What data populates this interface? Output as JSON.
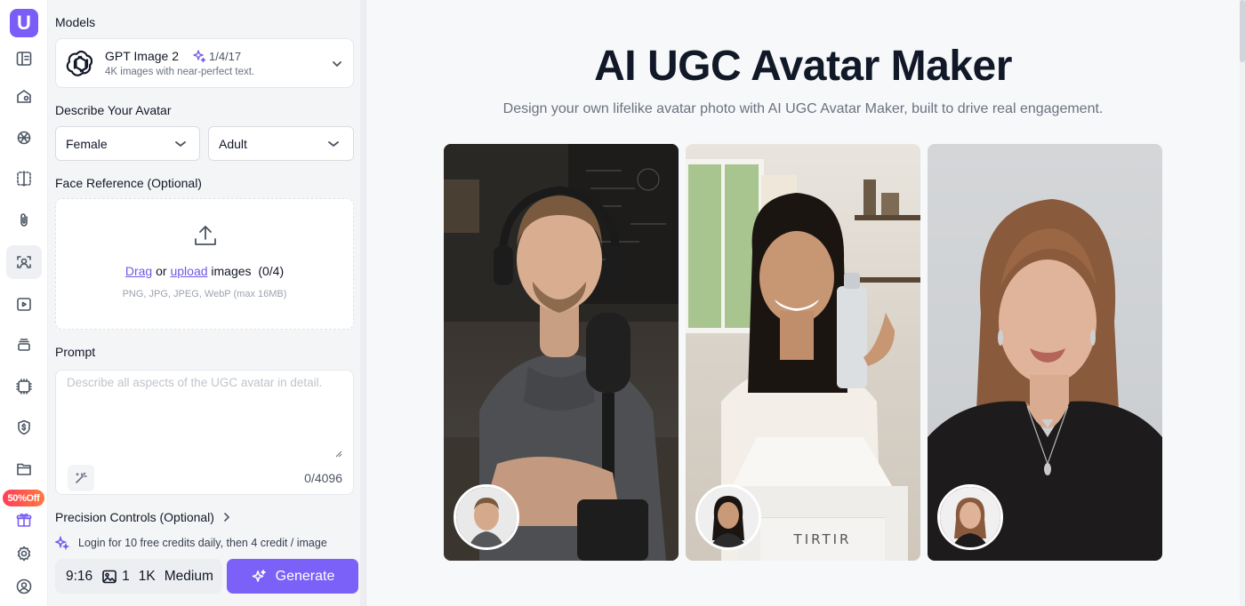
{
  "rail": {
    "logo": "U",
    "items": [
      "layout-icon",
      "house-icon",
      "openai-icon",
      "compare-icon",
      "paperclip-icon",
      "face-scan-icon",
      "video-add-icon",
      "stack-icon",
      "ai-chip-icon",
      "dollar-shield-icon",
      "folder-icon",
      "gift-icon",
      "settings-icon",
      "user-icon"
    ],
    "promo": "50%Off"
  },
  "panel": {
    "models_label": "Models",
    "model_name": "GPT Image 2",
    "model_version": "1/4/17",
    "model_desc": "4K images with near-perfect text.",
    "describe_label": "Describe Your Avatar",
    "gender": "Female",
    "age": "Adult",
    "face_label": "Face Reference (Optional)",
    "drag": "Drag",
    "or": "or",
    "upload": "upload",
    "images": "images",
    "upload_count": "(0/4)",
    "upload_hint": "PNG, JPG, JPEG, WebP (max 16MB)",
    "prompt_label": "Prompt",
    "prompt_placeholder": "Describe all aspects of the UGC avatar in detail.",
    "char_count": "0/4096",
    "precision_label": "Precision Controls (Optional)",
    "login_note": "Login for 10 free credits daily, then 4 credit / image",
    "aspect": "9:16",
    "image_count": "1",
    "resolution": "1K",
    "quality": "Medium",
    "generate": "Generate"
  },
  "main": {
    "title": "AI UGC Avatar Maker",
    "subtitle": "Design your own lifelike avatar photo with AI UGC Avatar Maker, built to drive real engagement.",
    "box_brand": "TIRTIR"
  },
  "colors": {
    "accent": "#7b61f7",
    "promo": "#ff3d5a"
  }
}
